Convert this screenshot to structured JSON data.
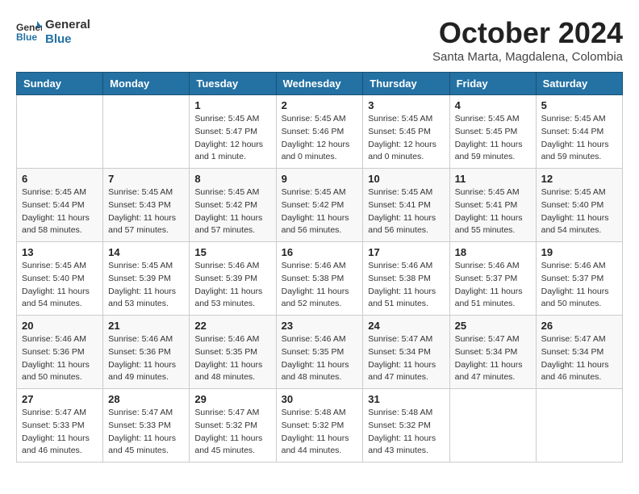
{
  "logo": {
    "general": "General",
    "blue": "Blue"
  },
  "title": "October 2024",
  "location": "Santa Marta, Magdalena, Colombia",
  "days_header": [
    "Sunday",
    "Monday",
    "Tuesday",
    "Wednesday",
    "Thursday",
    "Friday",
    "Saturday"
  ],
  "weeks": [
    [
      {
        "day": "",
        "info": ""
      },
      {
        "day": "",
        "info": ""
      },
      {
        "day": "1",
        "info": "Sunrise: 5:45 AM\nSunset: 5:47 PM\nDaylight: 12 hours\nand 1 minute."
      },
      {
        "day": "2",
        "info": "Sunrise: 5:45 AM\nSunset: 5:46 PM\nDaylight: 12 hours\nand 0 minutes."
      },
      {
        "day": "3",
        "info": "Sunrise: 5:45 AM\nSunset: 5:45 PM\nDaylight: 12 hours\nand 0 minutes."
      },
      {
        "day": "4",
        "info": "Sunrise: 5:45 AM\nSunset: 5:45 PM\nDaylight: 11 hours\nand 59 minutes."
      },
      {
        "day": "5",
        "info": "Sunrise: 5:45 AM\nSunset: 5:44 PM\nDaylight: 11 hours\nand 59 minutes."
      }
    ],
    [
      {
        "day": "6",
        "info": "Sunrise: 5:45 AM\nSunset: 5:44 PM\nDaylight: 11 hours\nand 58 minutes."
      },
      {
        "day": "7",
        "info": "Sunrise: 5:45 AM\nSunset: 5:43 PM\nDaylight: 11 hours\nand 57 minutes."
      },
      {
        "day": "8",
        "info": "Sunrise: 5:45 AM\nSunset: 5:42 PM\nDaylight: 11 hours\nand 57 minutes."
      },
      {
        "day": "9",
        "info": "Sunrise: 5:45 AM\nSunset: 5:42 PM\nDaylight: 11 hours\nand 56 minutes."
      },
      {
        "day": "10",
        "info": "Sunrise: 5:45 AM\nSunset: 5:41 PM\nDaylight: 11 hours\nand 56 minutes."
      },
      {
        "day": "11",
        "info": "Sunrise: 5:45 AM\nSunset: 5:41 PM\nDaylight: 11 hours\nand 55 minutes."
      },
      {
        "day": "12",
        "info": "Sunrise: 5:45 AM\nSunset: 5:40 PM\nDaylight: 11 hours\nand 54 minutes."
      }
    ],
    [
      {
        "day": "13",
        "info": "Sunrise: 5:45 AM\nSunset: 5:40 PM\nDaylight: 11 hours\nand 54 minutes."
      },
      {
        "day": "14",
        "info": "Sunrise: 5:45 AM\nSunset: 5:39 PM\nDaylight: 11 hours\nand 53 minutes."
      },
      {
        "day": "15",
        "info": "Sunrise: 5:46 AM\nSunset: 5:39 PM\nDaylight: 11 hours\nand 53 minutes."
      },
      {
        "day": "16",
        "info": "Sunrise: 5:46 AM\nSunset: 5:38 PM\nDaylight: 11 hours\nand 52 minutes."
      },
      {
        "day": "17",
        "info": "Sunrise: 5:46 AM\nSunset: 5:38 PM\nDaylight: 11 hours\nand 51 minutes."
      },
      {
        "day": "18",
        "info": "Sunrise: 5:46 AM\nSunset: 5:37 PM\nDaylight: 11 hours\nand 51 minutes."
      },
      {
        "day": "19",
        "info": "Sunrise: 5:46 AM\nSunset: 5:37 PM\nDaylight: 11 hours\nand 50 minutes."
      }
    ],
    [
      {
        "day": "20",
        "info": "Sunrise: 5:46 AM\nSunset: 5:36 PM\nDaylight: 11 hours\nand 50 minutes."
      },
      {
        "day": "21",
        "info": "Sunrise: 5:46 AM\nSunset: 5:36 PM\nDaylight: 11 hours\nand 49 minutes."
      },
      {
        "day": "22",
        "info": "Sunrise: 5:46 AM\nSunset: 5:35 PM\nDaylight: 11 hours\nand 48 minutes."
      },
      {
        "day": "23",
        "info": "Sunrise: 5:46 AM\nSunset: 5:35 PM\nDaylight: 11 hours\nand 48 minutes."
      },
      {
        "day": "24",
        "info": "Sunrise: 5:47 AM\nSunset: 5:34 PM\nDaylight: 11 hours\nand 47 minutes."
      },
      {
        "day": "25",
        "info": "Sunrise: 5:47 AM\nSunset: 5:34 PM\nDaylight: 11 hours\nand 47 minutes."
      },
      {
        "day": "26",
        "info": "Sunrise: 5:47 AM\nSunset: 5:34 PM\nDaylight: 11 hours\nand 46 minutes."
      }
    ],
    [
      {
        "day": "27",
        "info": "Sunrise: 5:47 AM\nSunset: 5:33 PM\nDaylight: 11 hours\nand 46 minutes."
      },
      {
        "day": "28",
        "info": "Sunrise: 5:47 AM\nSunset: 5:33 PM\nDaylight: 11 hours\nand 45 minutes."
      },
      {
        "day": "29",
        "info": "Sunrise: 5:47 AM\nSunset: 5:32 PM\nDaylight: 11 hours\nand 45 minutes."
      },
      {
        "day": "30",
        "info": "Sunrise: 5:48 AM\nSunset: 5:32 PM\nDaylight: 11 hours\nand 44 minutes."
      },
      {
        "day": "31",
        "info": "Sunrise: 5:48 AM\nSunset: 5:32 PM\nDaylight: 11 hours\nand 43 minutes."
      },
      {
        "day": "",
        "info": ""
      },
      {
        "day": "",
        "info": ""
      }
    ]
  ]
}
